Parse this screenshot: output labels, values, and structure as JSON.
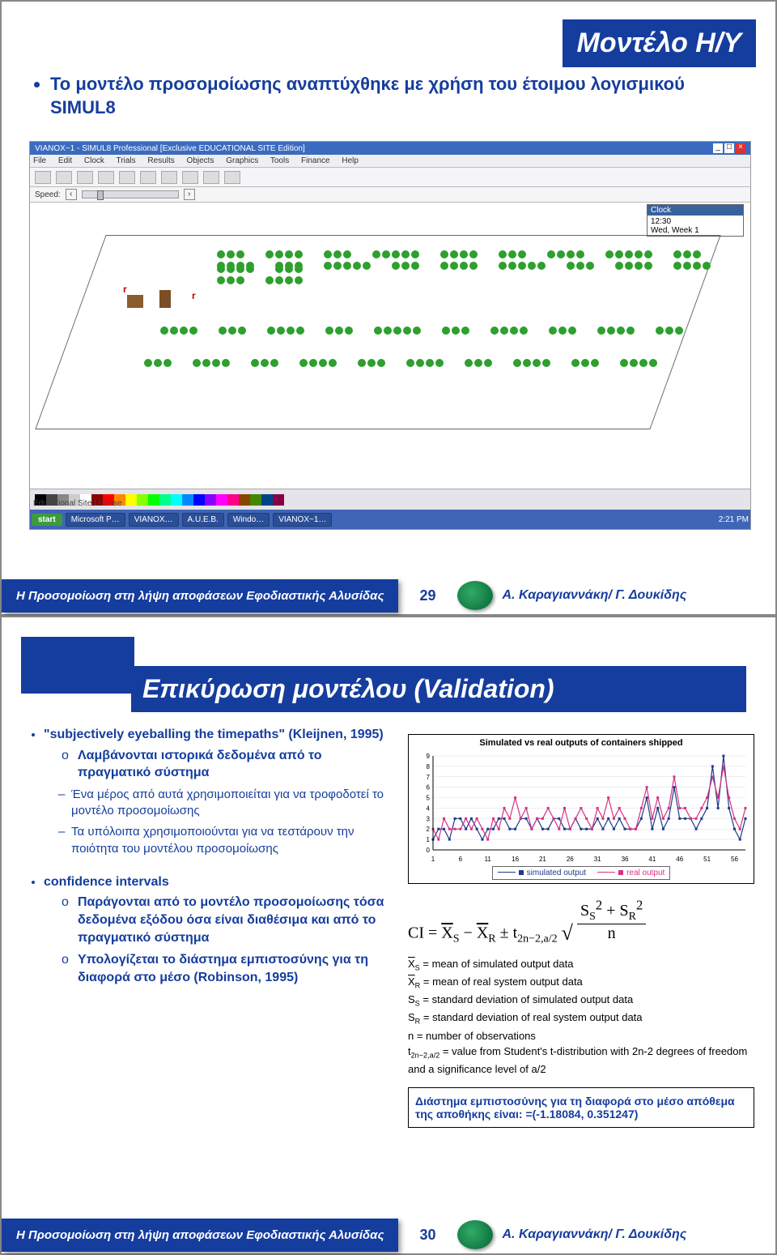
{
  "slide1": {
    "title": "Μοντέλο Η/Υ",
    "bullet": "Το μοντέλο προσομοίωσης αναπτύχθηκε με χρήση του έτοιμου λογισμικού SIMUL8",
    "sim8_title": "VIANOX~1 - SIMUL8 Professional [Exclusive EDUCATIONAL SITE Edition]",
    "menu": [
      "File",
      "Edit",
      "Clock",
      "Trials",
      "Results",
      "Objects",
      "Graphics",
      "Tools",
      "Finance",
      "Help"
    ],
    "speed_label": "Speed:",
    "clock_title": "Clock",
    "clock_time": "12:30",
    "clock_day": "Wed, Week 1",
    "status_lic": "Educational Site License",
    "taskbar_start": "start",
    "taskbar_items": [
      "Microsoft P…",
      "VIANOX…",
      "A.U.E.B.",
      "Windo…",
      "VIANOX~1…"
    ],
    "taskbar_time": "2:21 PM",
    "r_label": "r"
  },
  "slide2": {
    "title": "Επικύρωση μοντέλου (Validation)",
    "h1": "\"subjectively eyeballing the timepaths\" (Kleijnen, 1995)",
    "h1_b1": "Λαμβάνονται ιστορικά δεδομένα από το πραγματικό σύστημα",
    "h1_s1": "Ένα μέρος από αυτά χρησιμοποιείται για να τροφοδοτεί το μοντέλο προσομοίωσης",
    "h1_s2": "Τα υπόλοιπα χρησιμοποιούνται για να τεστάρουν την ποιότητα του μοντέλου προσομοίωσης",
    "h2": "confidence intervals",
    "h2_b1": "Παράγονται από το μοντέλο προσομοίωσης τόσα δεδομένα εξόδου όσα είναι διαθέσιμα και από το πραγματικό σύστημα",
    "h2_b2": "Υπολογίζεται το διάστημα εμπιστοσύνης για τη διαφορά στο μέσο (Robinson, 1995)",
    "chart_title": "Simulated vs real outputs of containers shipped",
    "legend_sim": "simulated output",
    "legend_real": "real output",
    "ci_left": "CI",
    "ci_eq": "=",
    "ci_rest": "± t",
    "defs": {
      "xs": "= mean of simulated output data",
      "xr": "= mean of real system output data",
      "ss": "= standard deviation of simulated output data",
      "sr": "= standard deviation of real system output data",
      "n": "= number of observations",
      "t": "= value from Student's t-distribution with 2n-2 degrees of freedom and a significance level of a/2"
    },
    "interval_box": "Διάστημα εμπιστοσύνης για τη διαφορά στο μέσο απόθεμα της αποθήκης είναι: =(-1.18084, 0.351247)"
  },
  "footer": {
    "left": "Η Προσομοίωση στη λήψη αποφάσεων Εφοδιαστικής Αλυσίδας",
    "authors": "Α. Καραγιαννάκη/ Γ. Δουκίδης",
    "p29": "29",
    "p30": "30"
  },
  "chart_data": {
    "type": "line",
    "title": "Simulated vs real outputs of containers shipped",
    "xlabel": "",
    "ylabel": "",
    "ylim": [
      0,
      9
    ],
    "x": [
      1,
      6,
      11,
      16,
      21,
      26,
      31,
      36,
      41,
      46,
      51,
      56
    ],
    "x_points": [
      1,
      2,
      3,
      4,
      5,
      6,
      7,
      8,
      9,
      10,
      11,
      12,
      13,
      14,
      15,
      16,
      17,
      18,
      19,
      20,
      21,
      22,
      23,
      24,
      25,
      26,
      27,
      28,
      29,
      30,
      31,
      32,
      33,
      34,
      35,
      36,
      37,
      38,
      39,
      40,
      41,
      42,
      43,
      44,
      45,
      46,
      47,
      48,
      49,
      50,
      51,
      52,
      53,
      54,
      55,
      56,
      57,
      58
    ],
    "series": [
      {
        "name": "simulated output",
        "color": "#1e3a8a",
        "values": [
          1,
          2,
          2,
          1,
          3,
          3,
          2,
          3,
          2,
          1,
          2,
          2,
          3,
          3,
          2,
          2,
          3,
          3,
          2,
          3,
          2,
          2,
          3,
          3,
          2,
          2,
          3,
          2,
          2,
          2,
          3,
          2,
          3,
          2,
          3,
          2,
          2,
          2,
          3,
          5,
          2,
          4,
          2,
          3,
          6,
          3,
          3,
          3,
          2,
          3,
          4,
          8,
          4,
          9,
          4,
          2,
          1,
          3
        ]
      },
      {
        "name": "real output",
        "color": "#d63384",
        "values": [
          2,
          1,
          3,
          2,
          2,
          2,
          3,
          2,
          3,
          2,
          1,
          3,
          2,
          4,
          3,
          5,
          3,
          4,
          2,
          3,
          3,
          4,
          3,
          2,
          4,
          2,
          3,
          4,
          3,
          2,
          4,
          3,
          5,
          3,
          4,
          3,
          2,
          2,
          4,
          6,
          3,
          5,
          3,
          4,
          7,
          4,
          4,
          3,
          3,
          4,
          5,
          7,
          5,
          8,
          5,
          3,
          2,
          4
        ]
      }
    ]
  }
}
